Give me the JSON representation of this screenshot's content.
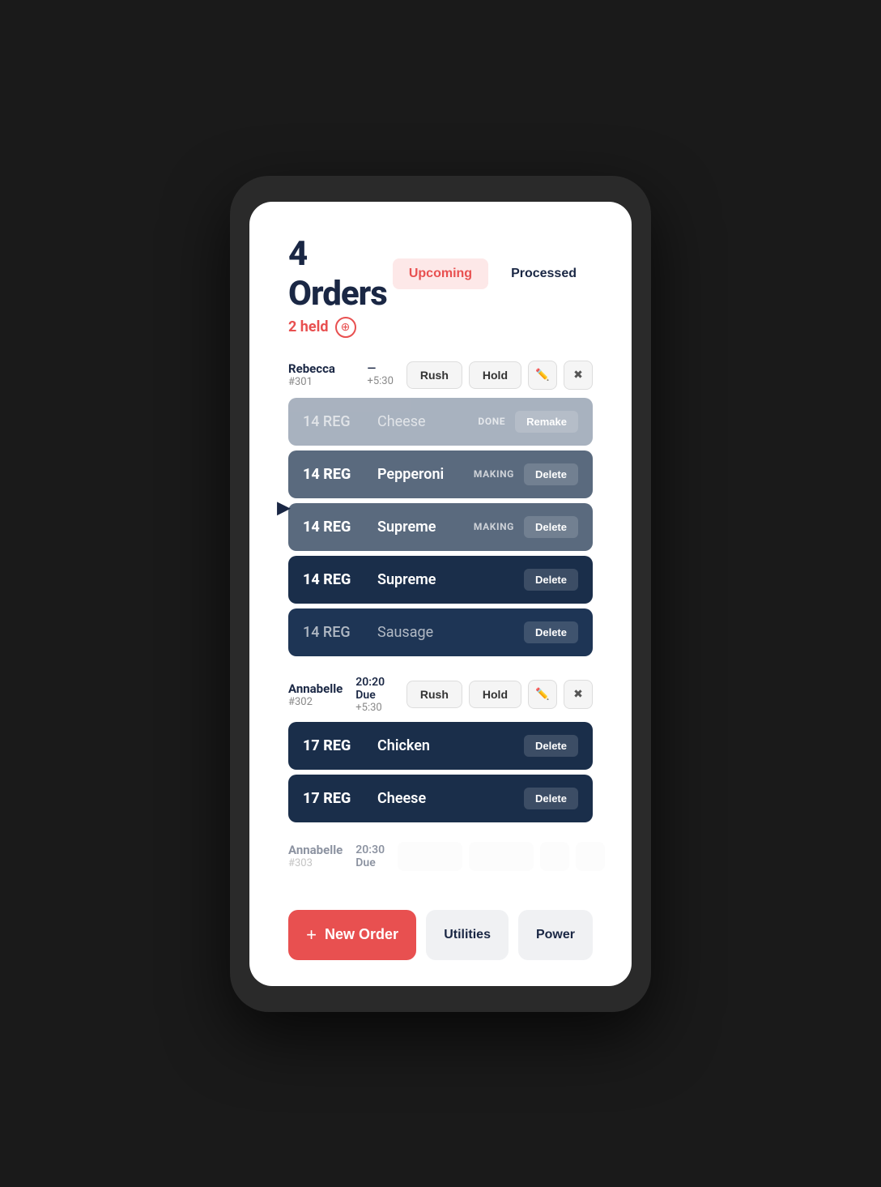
{
  "page": {
    "title": "4 Orders",
    "held": {
      "text": "2 held",
      "icon": "⊕"
    },
    "tabs": [
      {
        "id": "upcoming",
        "label": "Upcoming",
        "active": true
      },
      {
        "id": "processed",
        "label": "Processed",
        "active": false
      }
    ]
  },
  "orders": [
    {
      "id": "order-1",
      "name": "Rebecca",
      "number": "#301",
      "time": "—",
      "plus_time": "+5:30",
      "items": [
        {
          "size": "14 REG",
          "topping": "Cheese",
          "status": "DONE",
          "action": "Remake",
          "style": "done"
        },
        {
          "size": "14 REG",
          "topping": "Pepperoni",
          "status": "MAKING",
          "action": "Delete",
          "style": "making"
        },
        {
          "size": "14 REG",
          "topping": "Supreme",
          "status": "MAKING",
          "action": "Delete",
          "style": "making"
        },
        {
          "size": "14 REG",
          "topping": "Supreme",
          "status": "",
          "action": "Delete",
          "style": "queued-dark"
        },
        {
          "size": "14 REG",
          "topping": "Sausage",
          "status": "",
          "action": "Delete",
          "style": "queued"
        }
      ],
      "show_arrow": true
    },
    {
      "id": "order-2",
      "name": "Annabelle",
      "number": "#302",
      "time": "20:20 Due",
      "plus_time": "+5:30",
      "items": [
        {
          "size": "17 REG",
          "topping": "Chicken",
          "status": "",
          "action": "Delete",
          "style": "queued"
        },
        {
          "size": "17 REG",
          "topping": "Cheese",
          "status": "",
          "action": "Delete",
          "style": "queued"
        }
      ],
      "show_arrow": false
    },
    {
      "id": "order-3",
      "name": "Annabelle",
      "number": "#303",
      "time": "20:30 Due",
      "plus_time": "",
      "items": [],
      "truncated": true,
      "show_arrow": false
    }
  ],
  "footer": {
    "new_order_label": "New Order",
    "utilities_label": "Utilities",
    "power_label": "Power"
  }
}
